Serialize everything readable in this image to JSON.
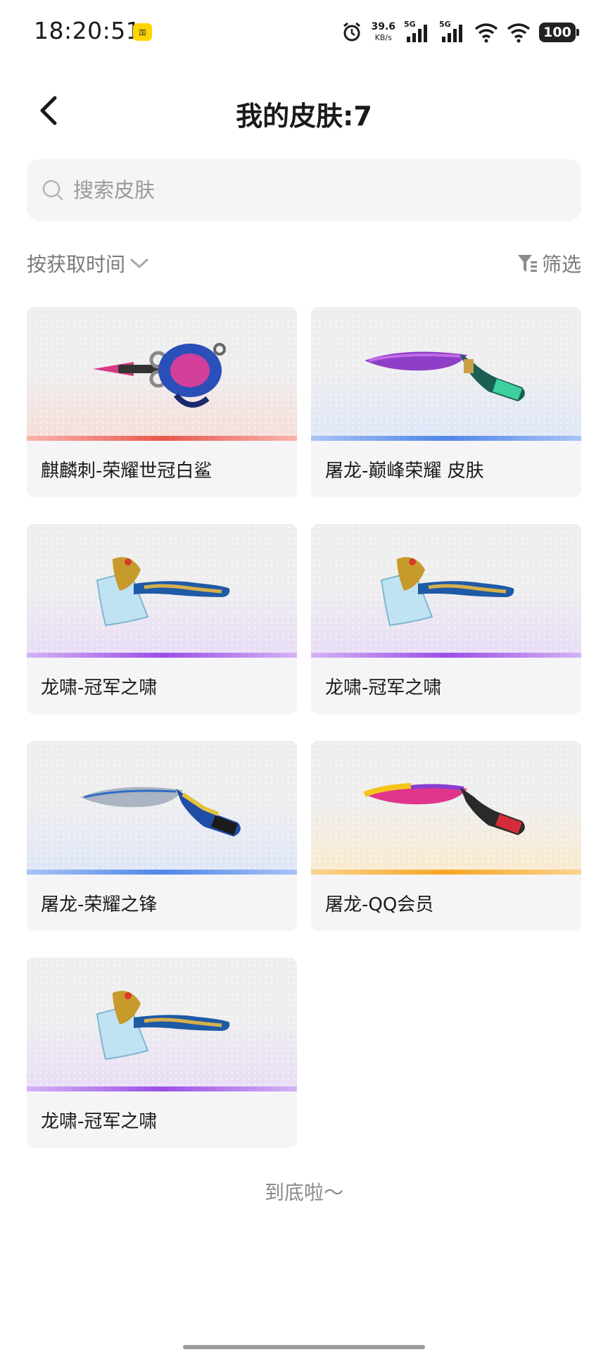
{
  "status_bar": {
    "time": "18:20:51",
    "badge_text": "国",
    "net_speed_value": "39.6",
    "net_speed_unit": "KB/s",
    "sim1_label": "5G",
    "sim2_label": "5G",
    "battery": "100",
    "icons": [
      "alarm-icon",
      "signal-icon",
      "signal-icon",
      "wifi-icon",
      "wifi-icon",
      "battery-icon"
    ]
  },
  "header": {
    "title": "我的皮肤:7",
    "back_icon": "chevron-left-icon"
  },
  "search": {
    "placeholder": "搜索皮肤",
    "value": ""
  },
  "toolbar": {
    "sort_label": "按获取时间",
    "filter_label": "筛选"
  },
  "skins": [
    {
      "name": "麒麟刺-荣耀世冠白鲨",
      "weapon": "claw-blade",
      "bar_color": "#e8574b",
      "tint": "#f7d9d6"
    },
    {
      "name": "屠龙-巅峰荣耀 皮肤",
      "weapon": "machete-purple",
      "bar_color": "#4f86e8",
      "tint": "#dbe4f7"
    },
    {
      "name": "龙啸-冠军之啸",
      "weapon": "axe",
      "bar_color": "#9b4ee6",
      "tint": "#eadcf8"
    },
    {
      "name": "龙啸-冠军之啸",
      "weapon": "axe",
      "bar_color": "#9b4ee6",
      "tint": "#eadcf8"
    },
    {
      "name": "屠龙-荣耀之锋",
      "weapon": "machete-blue",
      "bar_color": "#4f86e8",
      "tint": "#dbe4f7"
    },
    {
      "name": "屠龙-QQ会员",
      "weapon": "machete-gold",
      "bar_color": "#f5a623",
      "tint": "#fbe9cc"
    },
    {
      "name": "龙啸-冠军之啸",
      "weapon": "axe",
      "bar_color": "#9b4ee6",
      "tint": "#eadcf8"
    }
  ],
  "footer": {
    "end_text": "到底啦～"
  }
}
